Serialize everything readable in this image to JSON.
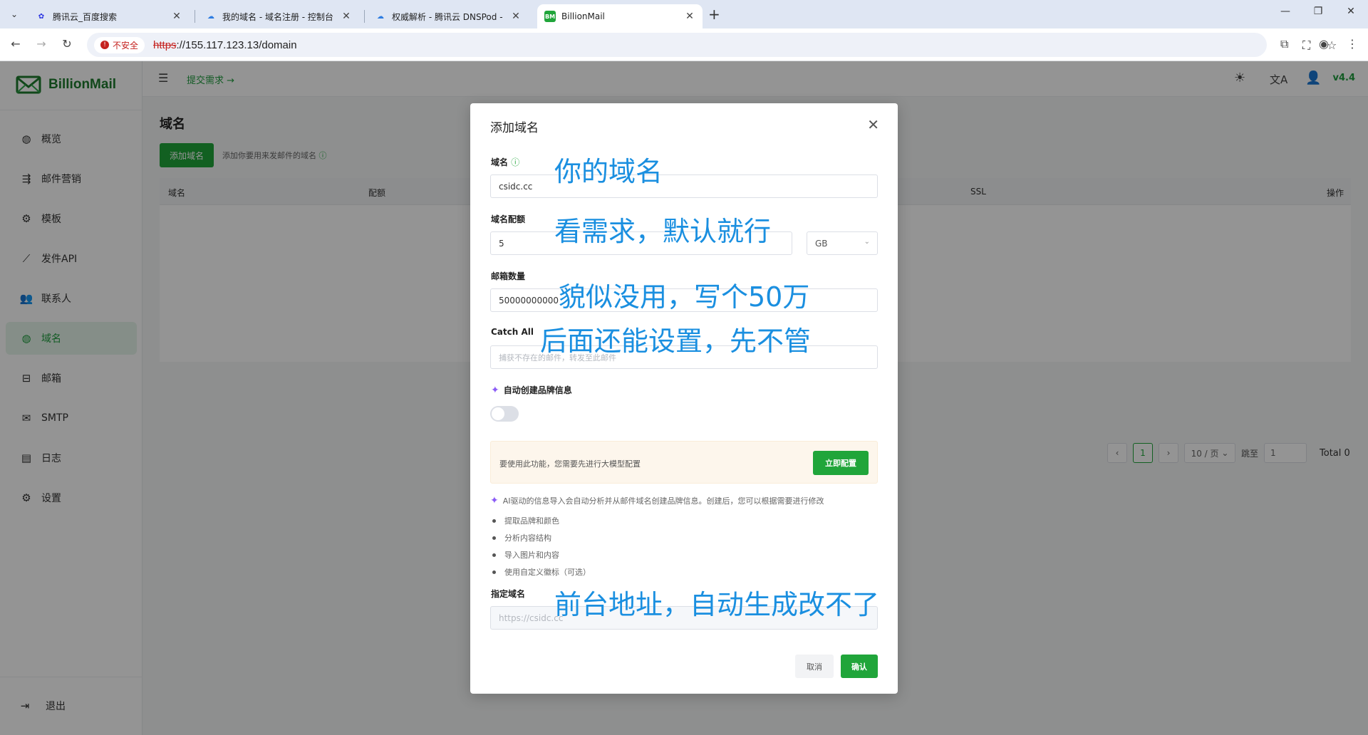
{
  "browser": {
    "tabs": [
      {
        "title": "腾讯云_百度搜索",
        "icon": "baidu-paw-icon",
        "active": false
      },
      {
        "title": "我的域名 - 域名注册 - 控制台",
        "icon": "cloud-icon",
        "active": false
      },
      {
        "title": "权威解析 - 腾讯云 DNSPod - 扌",
        "icon": "cloud-icon",
        "active": false
      },
      {
        "title": "BillionMail",
        "icon": "billionmail-favicon",
        "favicon_text": "BM",
        "active": true
      }
    ],
    "security_label": "不安全",
    "url_scheme": "https",
    "url_rest": "://155.117.123.13/domain"
  },
  "app": {
    "brand": "BillionMail",
    "version": "v4.4",
    "submit_request": "提交需求 →",
    "nav": [
      {
        "label": "概览",
        "icon": "globe-icon"
      },
      {
        "label": "邮件营销",
        "icon": "campaign-icon"
      },
      {
        "label": "模板",
        "icon": "gear-icon"
      },
      {
        "label": "发件API",
        "icon": "chart-line-icon"
      },
      {
        "label": "联系人",
        "icon": "users-icon"
      },
      {
        "label": "域名",
        "icon": "globe-icon",
        "active": true
      },
      {
        "label": "邮箱",
        "icon": "inbox-icon"
      },
      {
        "label": "SMTP",
        "icon": "mail-send-icon"
      },
      {
        "label": "日志",
        "icon": "document-icon"
      },
      {
        "label": "设置",
        "icon": "gear-icon"
      }
    ],
    "logout": "退出",
    "page_title": "域名",
    "add_button": "添加域名",
    "add_hint": "添加你要用来发邮件的域名",
    "table_columns": [
      "域名",
      "配额",
      "SSL",
      "操作"
    ],
    "pagination": {
      "current": "1",
      "page_size": "10 / 页",
      "jump_label": "跳至",
      "jump_value": "1",
      "total": "Total 0"
    }
  },
  "modal": {
    "title": "添加域名",
    "domain_label": "域名",
    "domain_value": "csidc.cc",
    "quota_label": "域名配额",
    "quota_value": "5",
    "quota_unit": "GB",
    "mailbox_label": "邮箱数量",
    "mailbox_value": "50000000000",
    "catchall_label": "Catch All",
    "catchall_placeholder": "捕获不存在的邮件，转发至此邮件",
    "brand_label": "自动创建品牌信息",
    "notice_text": "要使用此功能，您需要先进行大模型配置",
    "notice_button": "立即配置",
    "ai_desc": "AI驱动的信息导入会自动分析并从邮件域名创建品牌信息。创建后，您可以根据需要进行修改",
    "ai_bullets": [
      "提取品牌和颜色",
      "分析内容结构",
      "导入图片和内容",
      "使用自定义徽标（可选）"
    ],
    "site_label": "指定域名",
    "site_value": "https://csidc.cc",
    "cancel": "取消",
    "confirm": "确认"
  },
  "annotations": {
    "domain": "你的域名",
    "quota": "看需求，默认就行",
    "mailbox": "貌似没用，写个50万",
    "catchall": "后面还能设置，先不管",
    "site": "前台地址，自动生成改不了"
  },
  "colors": {
    "accent": "#20a53a",
    "annotation": "#1a8fe0",
    "danger": "#c5221f"
  }
}
